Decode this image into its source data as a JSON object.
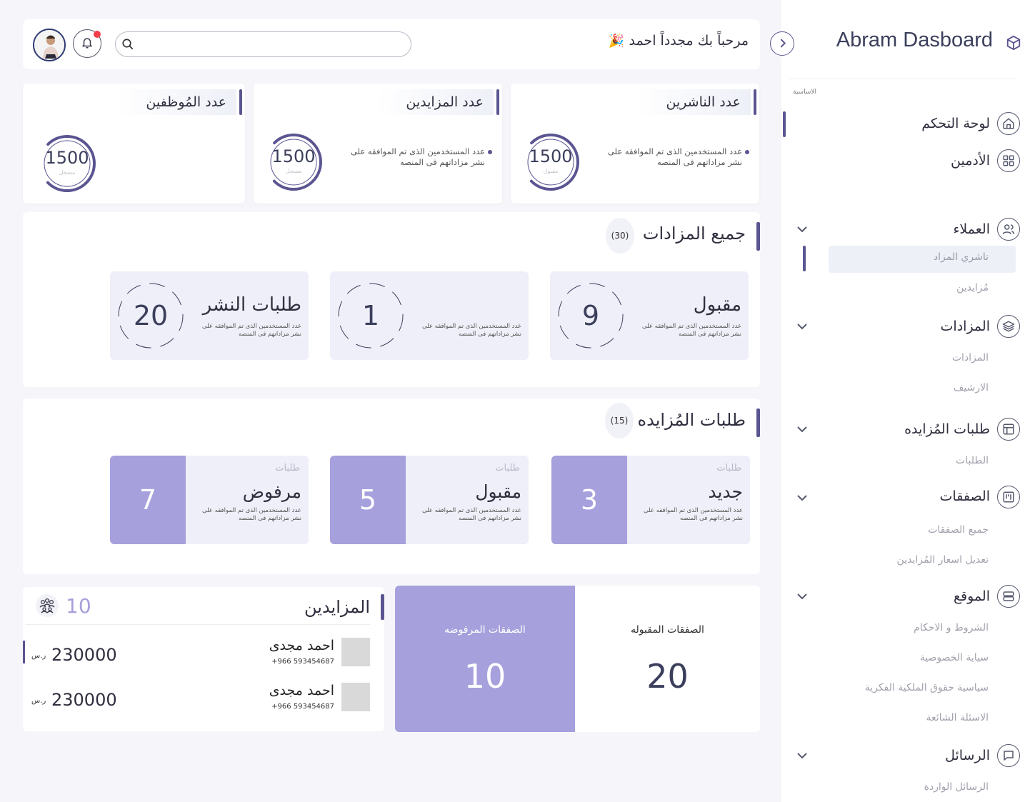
{
  "sidebar": {
    "brand": "Abram Dasboard",
    "section_title": "الاساسية",
    "main_items": [
      {
        "label": "لوحة التحكم",
        "icon": "home-icon"
      },
      {
        "label": "الأدمين",
        "icon": "grid-icon"
      }
    ],
    "groups": [
      {
        "label": "العملاء",
        "icon": "users-icon",
        "items": [
          "ناشري المزاد",
          "مُزايدين"
        ]
      },
      {
        "label": "المزادات",
        "icon": "layers-icon",
        "items": [
          "المزادات",
          "الارشيف"
        ]
      },
      {
        "label": "طلبات المُزايده",
        "icon": "layout-icon",
        "items": [
          "الطلبات"
        ]
      },
      {
        "label": "الصفقات",
        "icon": "kanban-icon",
        "items": [
          "جميع الصفقات",
          "تعديل اسعار المُزايدين"
        ]
      },
      {
        "label": "الموقع",
        "icon": "server-icon",
        "items": [
          "الشروط و الاحكام",
          "سياية الخصوصية",
          "سياسية حقوق الملكية الفكرية",
          "الاسئلة الشائعة"
        ]
      },
      {
        "label": "الرسائل",
        "icon": "message-icon",
        "items": [
          "الرسائل الواردة"
        ]
      }
    ]
  },
  "header": {
    "welcome": "مرحباً بك مجدداً احمد",
    "party": "🎉",
    "search_placeholder": ""
  },
  "stats": [
    {
      "title": "عدد الناشرين",
      "desc": "عدد المستخدمين الذى تم الموافقه على نشر مزاداتهم فى المنصه",
      "value": "1500",
      "sub": "مقبول",
      "fill": 0.75
    },
    {
      "title": "عدد المزايدين",
      "desc": "عدد المستخدمين الذى تم الموافقه على نشر مزاداتهم فى المنصه",
      "value": "1500",
      "sub": "مسجل",
      "fill": 0.75
    },
    {
      "title": "عدد المُوظفين",
      "desc": "",
      "value": "1500",
      "sub": "مسجل",
      "fill": 0.75
    }
  ],
  "auctions": {
    "title": "جميع المزادات",
    "count": "(30)",
    "cards": [
      {
        "title": "مقبول",
        "desc": "عدد المستخدمين الذى تم الموافقه على نشر مزاداتهم فى المنصه",
        "value": "9"
      },
      {
        "title": "",
        "desc": "عدد المستخدمين الذى تم الموافقه على نشر مزاداتهم فى المنصه",
        "value": "1"
      },
      {
        "title": "طلبات النشر",
        "desc": "عدد المستخدمين الذى تم الموافقه على نشر مزاداتهم فى المنصه",
        "value": "20"
      }
    ]
  },
  "requests": {
    "title": "طلبات المُزايده",
    "count": "(15)",
    "cards": [
      {
        "label": "طلبات",
        "title": "جديد",
        "desc": "عدد المستخدمين الذى تم الموافقه على نشر مزاداتهم فى المنصه",
        "value": "3"
      },
      {
        "label": "طلبات",
        "title": "مقبول",
        "desc": "عدد المستخدمين الذى تم الموافقه على نشر مزاداتهم فى المنصه",
        "value": "5"
      },
      {
        "label": "طلبات",
        "title": "مرفوض",
        "desc": "عدد المستخدمين الذى تم الموافقه على نشر مزاداتهم فى المنصه",
        "value": "7"
      }
    ]
  },
  "bidders": {
    "title": "المزايدين",
    "count": "10",
    "rows": [
      {
        "name": "احمد مجدى",
        "phone": "+966  593454687",
        "amount": "230000",
        "currency": "ر.س"
      },
      {
        "name": "احمد مجدى",
        "phone": "+966  593454687",
        "amount": "230000",
        "currency": "ر.س"
      }
    ]
  },
  "deals": {
    "rejected_label": "الصفقات المرفوضه",
    "rejected_value": "10",
    "accepted_label": "الصفقات المقبوله",
    "accepted_value": "20"
  },
  "colors": {
    "accent": "#5a5591",
    "light_accent": "#a6a0dc",
    "card_bg": "#efeff9"
  }
}
